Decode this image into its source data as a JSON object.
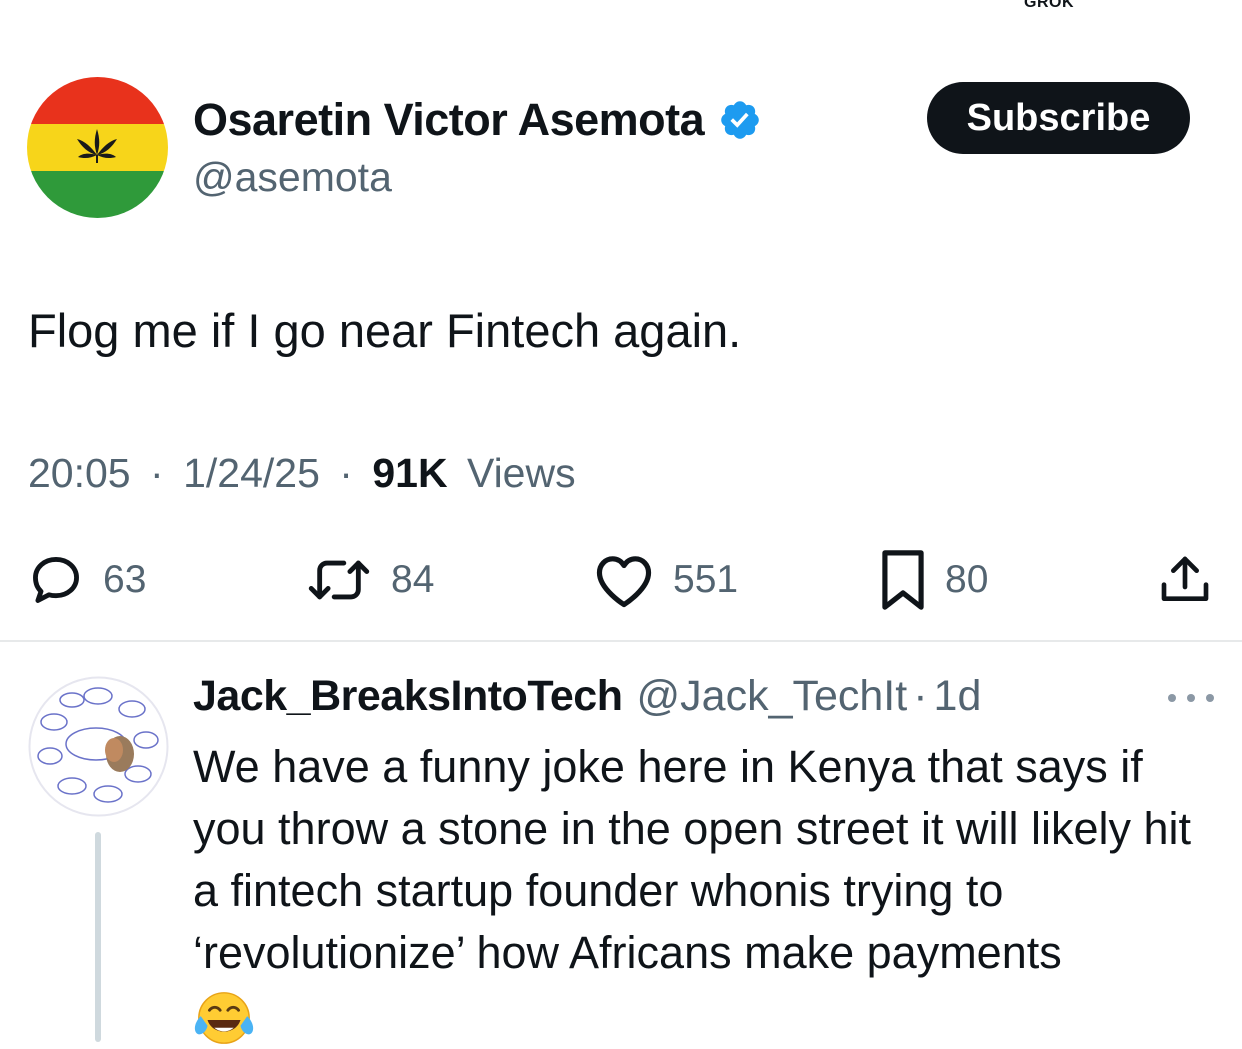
{
  "top": {
    "grok_label": "GROK"
  },
  "tweet": {
    "author": {
      "name": "Osaretin Victor Asemota",
      "handle": "@asemota",
      "verified": true,
      "avatar_icon": "flag-avatar-icon"
    },
    "subscribe_label": "Subscribe",
    "text": "Flog me if I go near Fintech again.",
    "time": "20:05",
    "date": "1/24/25",
    "views_count": "91K",
    "views_label": "Views",
    "separator": "·",
    "stats": {
      "replies": "63",
      "reposts": "84",
      "likes": "551",
      "bookmarks": "80"
    }
  },
  "reply": {
    "author": {
      "name": "Jack_BreaksIntoTech",
      "handle": "@Jack_TechIt",
      "avatar_icon": "product-management-diagram-avatar"
    },
    "separator": "·",
    "time": "1d",
    "text": "We have a funny joke here in Kenya that says if you throw a stone in the open street it will likely hit a fintech startup founder whonis trying to ‘revolutionize’ how Africans make payments",
    "emoji": "face-with-tears-of-joy"
  },
  "colors": {
    "text_primary": "#0f1419",
    "text_secondary": "#536471",
    "verified_blue": "#1d9bf0",
    "divider": "#e7e9ea",
    "thread_line": "#cfd9de",
    "subscribe_bg": "#0f1419"
  }
}
